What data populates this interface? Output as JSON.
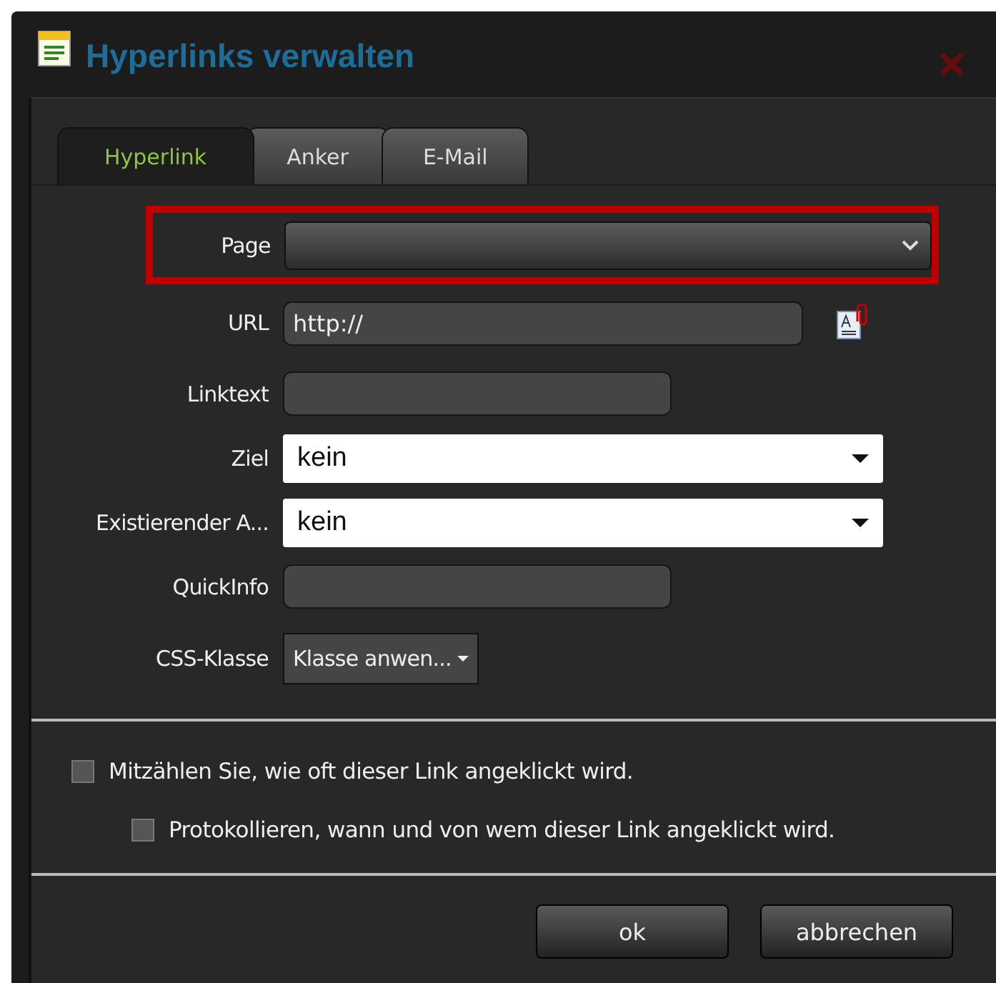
{
  "window": {
    "title": "Hyperlinks verwalten"
  },
  "tabs": [
    {
      "label": "Hyperlink",
      "selected": true
    },
    {
      "label": "Anker",
      "selected": false
    },
    {
      "label": "E-Mail",
      "selected": false
    }
  ],
  "fields": [
    {
      "label": "Page",
      "kind": "dark-select",
      "highlighted": true
    },
    {
      "label": "URL",
      "kind": "url",
      "value": "http://"
    },
    {
      "label": "Linktext",
      "kind": "text"
    },
    {
      "label": "Ziel",
      "kind": "white-select",
      "value": "kein"
    },
    {
      "label": "Existierender A...",
      "kind": "white-select",
      "value": "kein"
    },
    {
      "label": "QuickInfo",
      "kind": "text"
    },
    {
      "label": "CSS-Klasse",
      "kind": "small-select",
      "value": "Klasse anwen..."
    }
  ],
  "options": [
    {
      "label": "Mitzählen Sie, wie oft dieser Link angeklickt wird.",
      "checked": false,
      "indented": false
    },
    {
      "label": "Protokollieren, wann und von wem dieser Link angeklickt wird.",
      "checked": false,
      "indented": true
    }
  ],
  "buttons": [
    "ok",
    "abbrechen"
  ]
}
